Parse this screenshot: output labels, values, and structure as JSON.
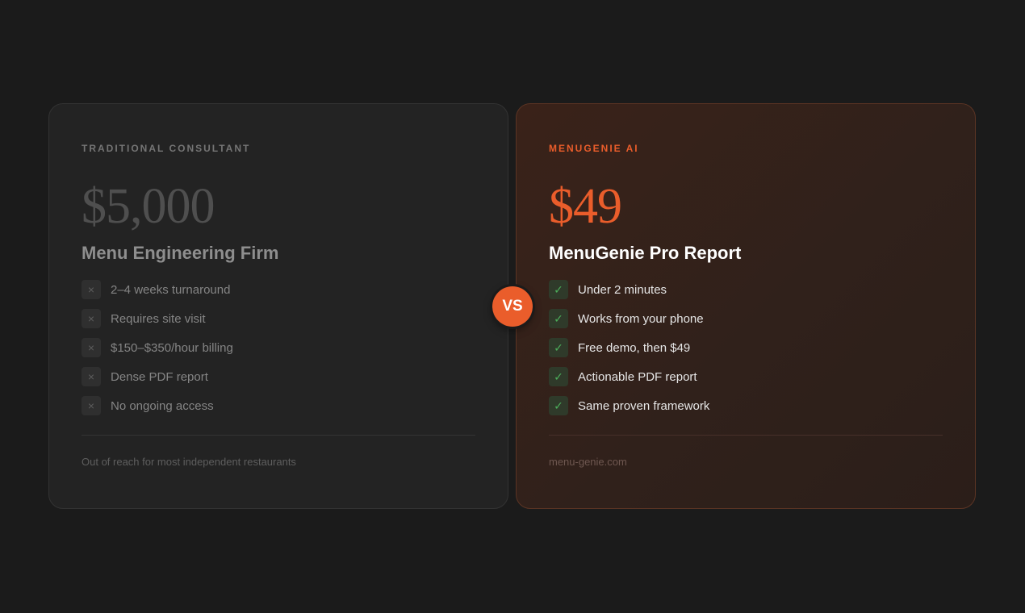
{
  "left_card": {
    "eyebrow": "TRADITIONAL CONSULTANT",
    "price": "$5,000",
    "product": "Menu Engineering Firm",
    "mark_glyph": "×",
    "mark_icon": "x-icon",
    "features": [
      "2–4 weeks turnaround",
      "Requires site visit",
      "$150–$350/hour billing",
      "Dense PDF report",
      "No ongoing access"
    ],
    "footnote": "Out of reach for most independent restaurants"
  },
  "right_card": {
    "eyebrow": "MENUGENIE AI",
    "price": "$49",
    "product": "MenuGenie Pro Report",
    "mark_glyph": "✓",
    "mark_icon": "check-icon",
    "features": [
      "Under 2 minutes",
      "Works from your phone",
      "Free demo, then $49",
      "Actionable PDF report",
      "Same proven framework"
    ],
    "footnote": "menu-genie.com"
  },
  "vs_badge": "VS",
  "colors": {
    "accent": "#ea5d2b",
    "background": "#1b1b1b",
    "check_green": "#4cae5a"
  }
}
